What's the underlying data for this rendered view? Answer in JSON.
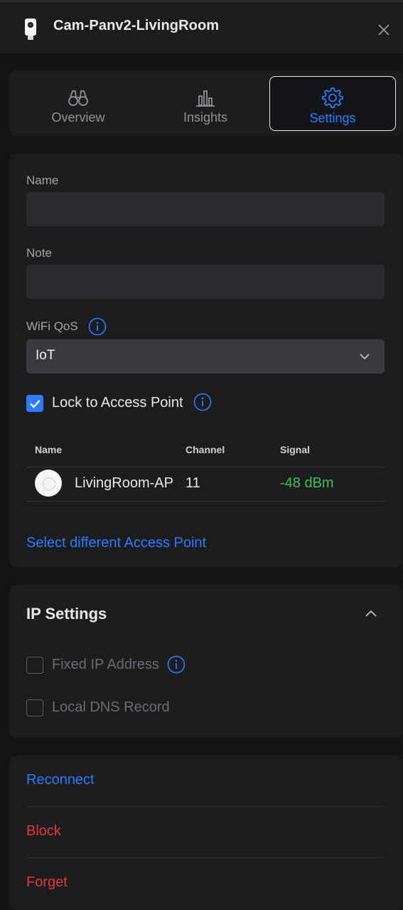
{
  "header": {
    "title": "Cam-Panv2-LivingRoom",
    "device_icon": "camera-device-icon",
    "close_icon": "close-icon"
  },
  "tabs": [
    {
      "label": "Overview",
      "icon": "binoculars-icon",
      "active": false
    },
    {
      "label": "Insights",
      "icon": "bar-chart-icon",
      "active": false
    },
    {
      "label": "Settings",
      "icon": "gear-icon",
      "active": true
    }
  ],
  "settings": {
    "name_label": "Name",
    "name_value": "",
    "note_label": "Note",
    "note_value": "",
    "wifi_qos_label": "WiFi QoS",
    "wifi_qos_value": "IoT",
    "lock_label": "Lock to Access Point",
    "lock_checked": true,
    "table": {
      "headers": [
        "Name",
        "Channel",
        "Signal"
      ],
      "rows": [
        {
          "name": "LivingRoom-AP",
          "channel": "11",
          "signal": "-48 dBm"
        }
      ]
    },
    "select_ap_link": "Select different Access Point"
  },
  "ip_settings": {
    "title": "IP Settings",
    "fixed_ip_label": "Fixed IP Address",
    "fixed_ip_checked": false,
    "local_dns_label": "Local DNS Record",
    "local_dns_checked": false
  },
  "actions": {
    "reconnect": "Reconnect",
    "block": "Block",
    "forget": "Forget"
  },
  "colors": {
    "accent": "#2f7bff",
    "danger": "#e5393a",
    "signal_good": "#3fbf5a",
    "background": "#131416",
    "card": "#1c1d1f"
  }
}
